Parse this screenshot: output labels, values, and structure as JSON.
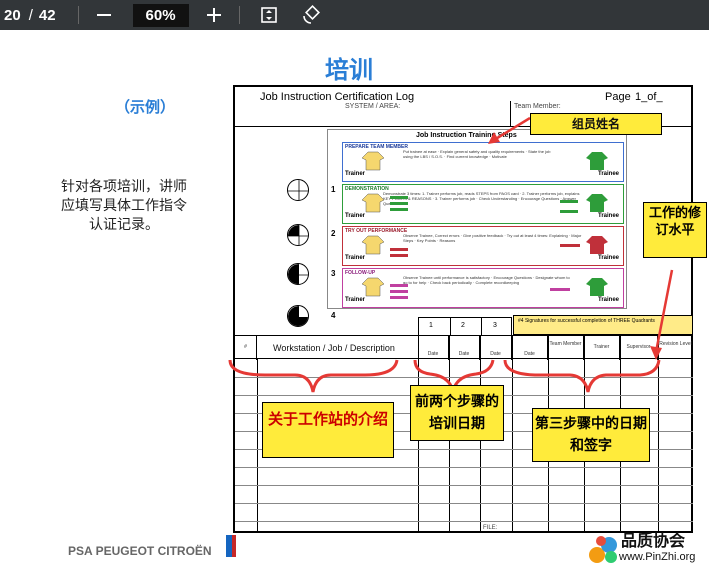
{
  "toolbar": {
    "page_current": "20",
    "page_separator": "/",
    "page_total": "42",
    "zoom": "60%"
  },
  "slide": {
    "title": "培训",
    "example": "（示例）",
    "desc": "针对各项培训，讲师应填写具体工作指令认证记录。",
    "brand": "PSA PEUGEOT CITROËN",
    "logo_cn": "品质协会",
    "logo_url": "www.PinZhi.org"
  },
  "form": {
    "title": "Job Instruction Certification Log",
    "system": "SYSTEM / AREA:",
    "team_member": "Team Member:",
    "page_label": "Page",
    "page_num": "1",
    "of_label": "of",
    "steps_title": "Job Instruction Training Steps",
    "steps": [
      {
        "name": "PREPARE TEAM MEMBER",
        "num": "1",
        "lines": "Put trainee at ease · Explain general safety and quality requirements · State the job using the LBS / S.O.S. · Find current knowledge · Motivate"
      },
      {
        "name": "DEMONSTRATION",
        "num": "2",
        "lines": "Demonstrate 3 times: 1. Trainer performs job, reads STEPS from PAOS card · 2. Trainer performs job, explains KEY POINTS & REASONS · 3. Trainer performs job · Check Understanding · Encourage Questions · Answer Questions"
      },
      {
        "name": "TRY OUT PERFORMANCE",
        "num": "3",
        "lines": "Observe Trainee, Correct errors · Give positive feedback · Try out at least 4 times: Explaining · Major Steps · Key Points · Reasons"
      },
      {
        "name": "FOLLOW-UP",
        "num": "4",
        "lines": "Observe Trainee until performance is satisfactory · Encourage Questions · Designate whom to go to for help · Check back periodically · Complete recordkeeping"
      }
    ],
    "trainer": "Trainer",
    "trainee": "Trainee",
    "col_nums": [
      "1",
      "2",
      "3"
    ],
    "sig_header": "#4  Signatures for successful completion of THREE Quadrants",
    "col_hash": "#",
    "col_ws": "Workstation / Job / Description",
    "col_date": "Date",
    "col_team": "Team Member",
    "col_trainer": "Trainer",
    "col_supervisor": "Supervisor",
    "col_revision": "Revision Level",
    "file": "FILE:"
  },
  "callouts": {
    "member_name": "组员姓名",
    "revision": "工作的修订水平",
    "workstation": "关于工作站的介绍",
    "first_two": "前两个步骤的培训日期",
    "third": "第三步骤中的日期和签字"
  }
}
